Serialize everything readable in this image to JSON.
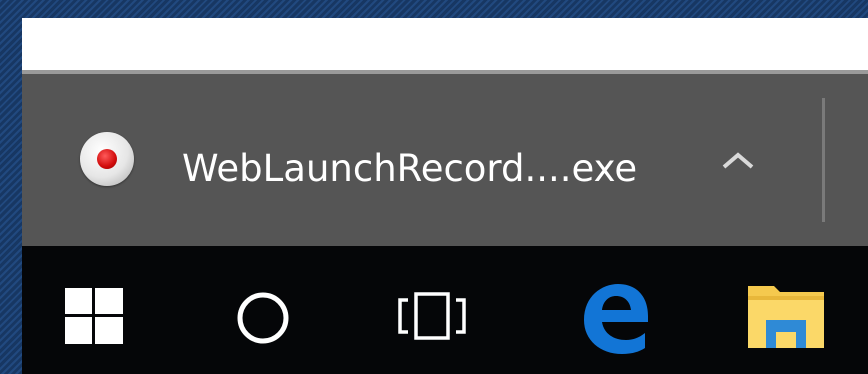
{
  "download_shelf": {
    "item": {
      "file_name": "WebLaunchRecord....exe",
      "icon": "record-icon",
      "menu_icon": "chevron-up-icon"
    }
  },
  "taskbar": {
    "buttons": [
      {
        "name": "start-button",
        "icon": "windows-logo-icon"
      },
      {
        "name": "cortana-button",
        "icon": "circle-icon"
      },
      {
        "name": "task-view-button",
        "icon": "task-view-icon"
      },
      {
        "name": "edge-button",
        "icon": "edge-icon"
      },
      {
        "name": "explorer-button",
        "icon": "folder-icon"
      }
    ]
  },
  "colors": {
    "shelf_bg": "#555555",
    "taskbar_bg": "#050608",
    "edge_blue": "#1275d6",
    "folder_yellow": "#f5c94e"
  }
}
